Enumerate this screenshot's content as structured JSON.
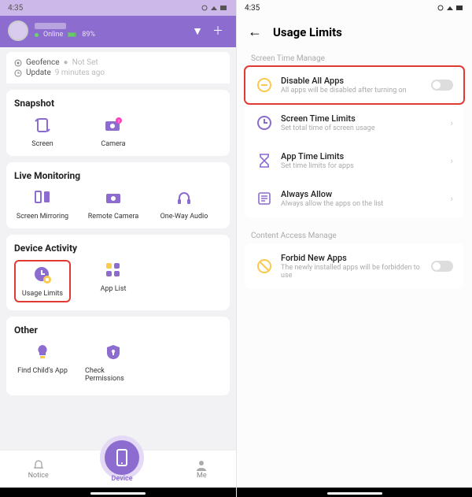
{
  "left": {
    "status_time": "4:35",
    "online_label": "Online",
    "battery": "89%",
    "geofence_label": "Geofence",
    "geofence_value": "Not Set",
    "update_label": "Update",
    "update_value": "9 minutes ago",
    "sections": {
      "snapshot": {
        "title": "Snapshot",
        "screen": "Screen",
        "camera": "Camera"
      },
      "live": {
        "title": "Live Monitoring",
        "mirror": "Screen Mirroring",
        "remote": "Remote Camera",
        "audio": "One-Way Audio"
      },
      "activity": {
        "title": "Device Activity",
        "usage": "Usage Limits",
        "applist": "App List"
      },
      "other": {
        "title": "Other",
        "find": "Find Child's App",
        "check": "Check Permissions"
      }
    },
    "nav": {
      "notice": "Notice",
      "device": "Device",
      "me": "Me"
    }
  },
  "right": {
    "status_time": "4:35",
    "title": "Usage Limits",
    "section1": "Screen Time Manage",
    "disable_title": "Disable All Apps",
    "disable_sub": "All apps will be disabled after turning on",
    "stl_title": "Screen Time Limits",
    "stl_sub": "Set total time of screen usage",
    "atl_title": "App Time Limits",
    "atl_sub": "Set time limits for apps",
    "aa_title": "Always Allow",
    "aa_sub": "Always allow the apps on the list",
    "section2": "Content Access Manage",
    "fna_title": "Forbid New Apps",
    "fna_sub": "The newly installed apps will be forbidden to use"
  }
}
